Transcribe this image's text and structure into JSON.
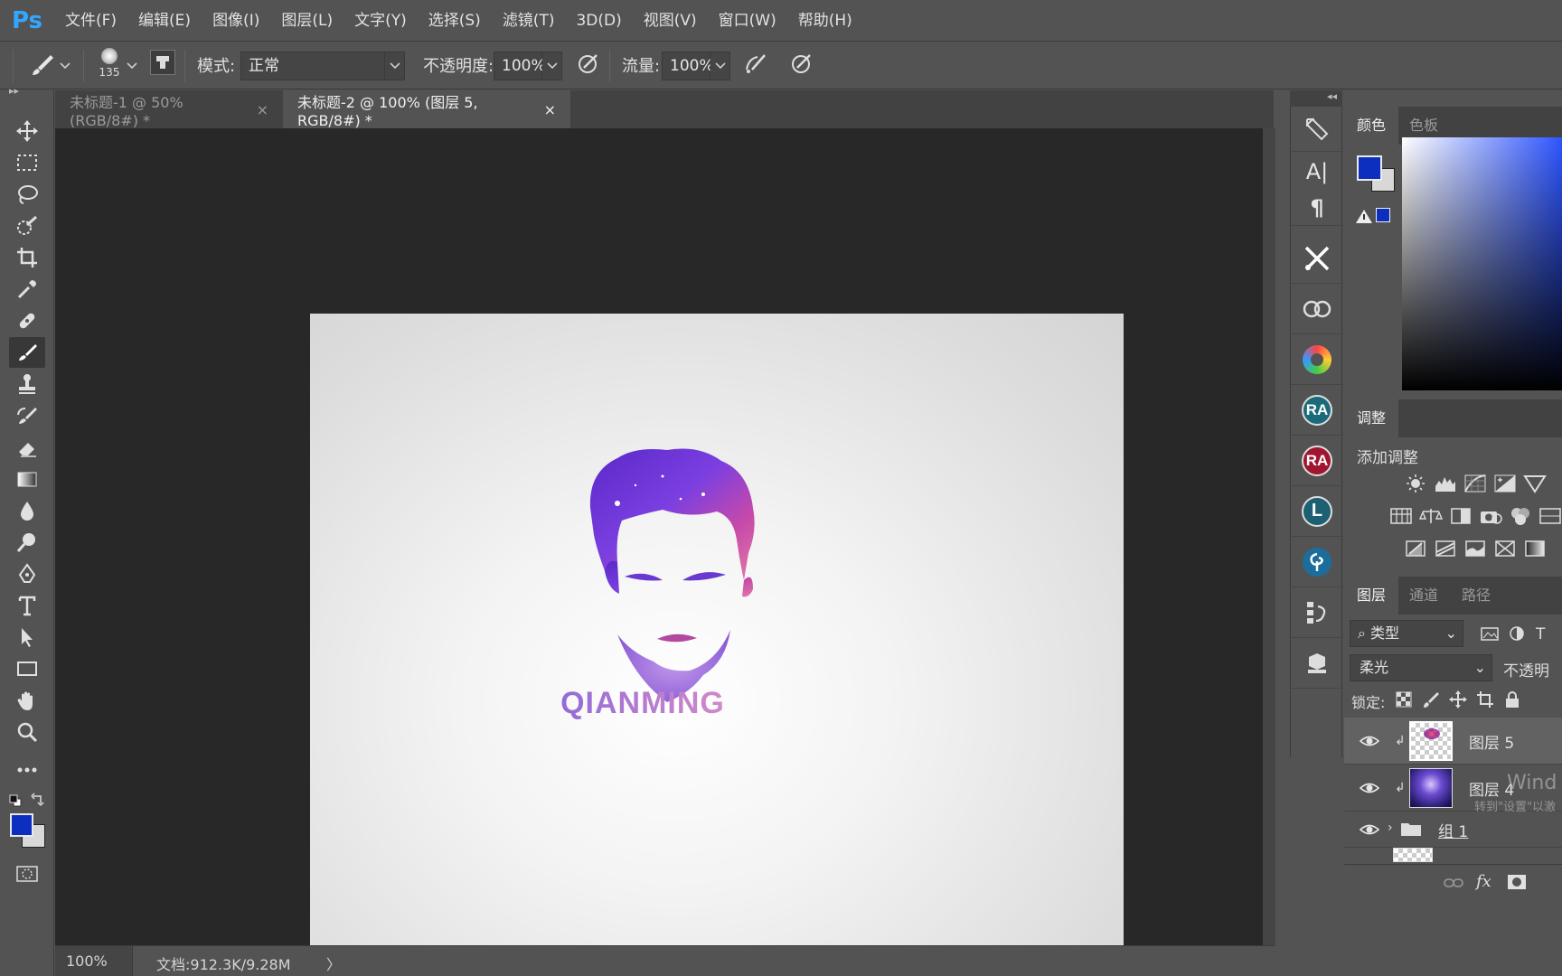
{
  "app": {
    "logo": "Ps"
  },
  "menu": [
    "文件(F)",
    "编辑(E)",
    "图像(I)",
    "图层(L)",
    "文字(Y)",
    "选择(S)",
    "滤镜(T)",
    "3D(D)",
    "视图(V)",
    "窗口(W)",
    "帮助(H)"
  ],
  "options": {
    "brush_size": "135",
    "mode_label": "模式:",
    "mode_value": "正常",
    "opacity_label": "不透明度:",
    "opacity_value": "100%",
    "flow_label": "流量:",
    "flow_value": "100%"
  },
  "tabs": [
    {
      "label": "未标题-1 @ 50%(RGB/8#) *",
      "active": false
    },
    {
      "label": "未标题-2 @ 100% (图层 5, RGB/8#) *",
      "active": true
    }
  ],
  "canvas": {
    "logo_text": "QIANMING"
  },
  "status": {
    "zoom": "100%",
    "doc": "文档:912.3K/9.28M",
    "arrow": "〉"
  },
  "colors": {
    "foreground": "#0c2fbf",
    "background": "#d8d8d8",
    "accent": "#31a8ff"
  },
  "dock": {
    "text_a": "A|",
    "pilcrow": "¶",
    "ra1": "RA",
    "ra2": "RA",
    "l": "L"
  },
  "color_panel": {
    "tabs": [
      "颜色",
      "色板"
    ]
  },
  "adjust_panel": {
    "tab": "调整",
    "add_label": "添加调整"
  },
  "layers_panel": {
    "tabs": [
      "图层",
      "通道",
      "路径"
    ],
    "filter_value": "类型",
    "blend_value": "柔光",
    "opacity_label": "不透明",
    "lock_label": "锁定:",
    "layers": [
      {
        "name": "图层 5",
        "type": "layer"
      },
      {
        "name": "图层 4",
        "type": "layer"
      },
      {
        "name": "组 1",
        "type": "group"
      }
    ]
  },
  "watermark": {
    "line1": "Wind",
    "line2": "转到\"设置\"以激"
  }
}
